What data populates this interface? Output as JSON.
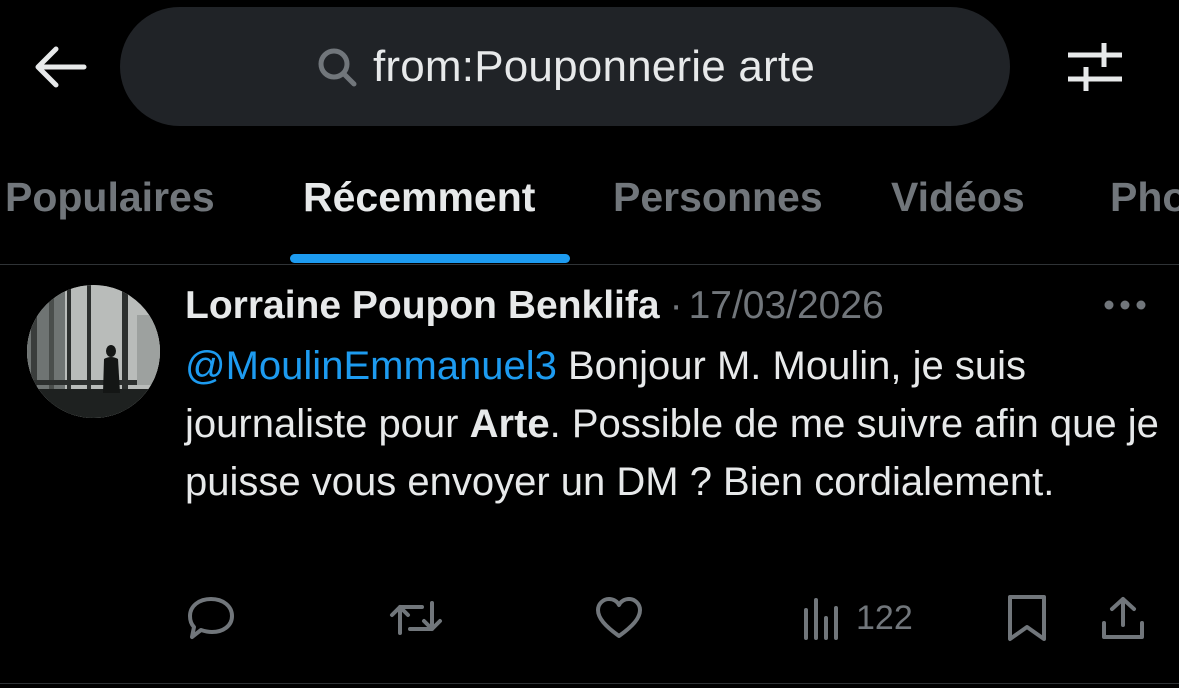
{
  "search": {
    "query": "from:Pouponnerie arte"
  },
  "tabs": [
    {
      "label": "Populaires",
      "active": false
    },
    {
      "label": "Récemment",
      "active": true
    },
    {
      "label": "Personnes",
      "active": false
    },
    {
      "label": "Vidéos",
      "active": false
    },
    {
      "label": "Photos",
      "active": false
    }
  ],
  "tweet": {
    "author_name": "Lorraine Poupon Benklifa",
    "separator": "·",
    "date": "17/03/2026",
    "mention": "@MoulinEmmanuel3",
    "text_part1": " Bonjour M. Moulin, je suis journaliste pour ",
    "bold_word": "Arte",
    "text_part2": ". Possible de me suivre afin que je puisse vous envoyer un DM ? Bien cordialement.",
    "views": "122"
  },
  "colors": {
    "background": "#000000",
    "search_bg": "#202327",
    "accent": "#1d9bf0",
    "text_primary": "#e7e9ea",
    "text_secondary": "#71767b",
    "divider": "#2f3336"
  },
  "icons": {
    "back": "arrow-left-icon",
    "search": "magnifier-icon",
    "filter": "sliders-icon",
    "more": "ellipsis-icon",
    "reply": "speech-bubble-icon",
    "repost": "repost-arrows-icon",
    "like": "heart-icon",
    "views": "bar-chart-icon",
    "bookmark": "bookmark-icon",
    "share": "share-upload-icon"
  }
}
